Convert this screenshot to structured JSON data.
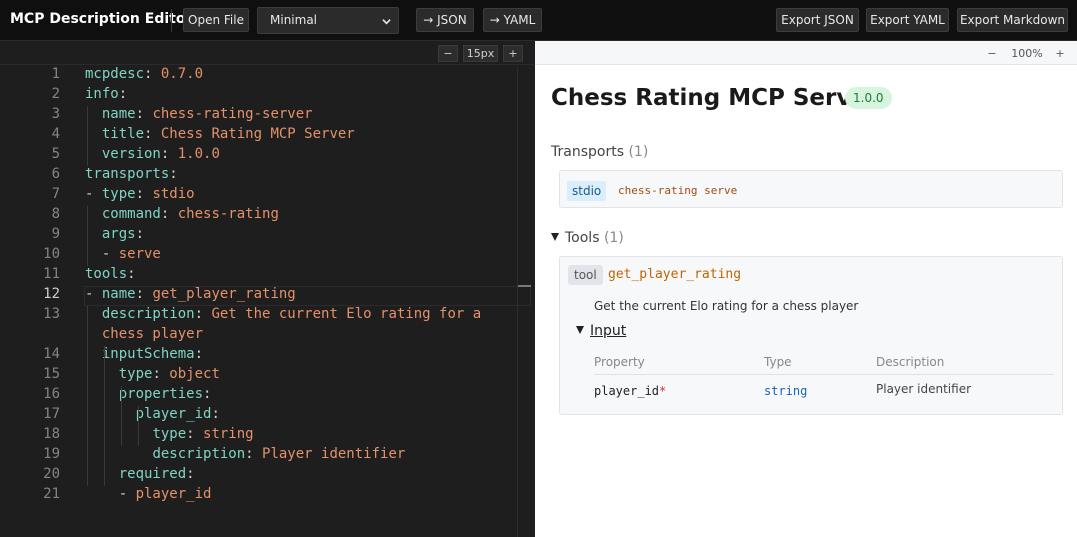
{
  "app": {
    "title": "MCP Description Editor"
  },
  "toolbar": {
    "open_file": "Open File",
    "preset_select": "Minimal",
    "to_json": "→ JSON",
    "to_yaml": "→ YAML",
    "export_json": "Export JSON",
    "export_yaml": "Export YAML",
    "export_markdown": "Export Markdown"
  },
  "editor": {
    "zoom_minus": "−",
    "font_size": "15px",
    "zoom_plus": "+",
    "active_line": 12,
    "lines": [
      {
        "n": "1",
        "tokens": [
          [
            "k",
            "mcpdesc"
          ],
          [
            "p",
            ": "
          ],
          [
            "v",
            "0.7.0"
          ]
        ]
      },
      {
        "n": "2",
        "tokens": [
          [
            "k",
            "info"
          ],
          [
            "p",
            ":"
          ]
        ]
      },
      {
        "n": "3",
        "tokens": [
          [
            "p",
            "  "
          ],
          [
            "k",
            "name"
          ],
          [
            "p",
            ": "
          ],
          [
            "v",
            "chess-rating-server"
          ]
        ]
      },
      {
        "n": "4",
        "tokens": [
          [
            "p",
            "  "
          ],
          [
            "k",
            "title"
          ],
          [
            "p",
            ": "
          ],
          [
            "v",
            "Chess Rating MCP Server"
          ]
        ]
      },
      {
        "n": "5",
        "tokens": [
          [
            "p",
            "  "
          ],
          [
            "k",
            "version"
          ],
          [
            "p",
            ": "
          ],
          [
            "v",
            "1.0.0"
          ]
        ]
      },
      {
        "n": "6",
        "tokens": [
          [
            "k",
            "transports"
          ],
          [
            "p",
            ":"
          ]
        ]
      },
      {
        "n": "7",
        "tokens": [
          [
            "p",
            "- "
          ],
          [
            "k",
            "type"
          ],
          [
            "p",
            ": "
          ],
          [
            "v",
            "stdio"
          ]
        ]
      },
      {
        "n": "8",
        "tokens": [
          [
            "p",
            "  "
          ],
          [
            "k",
            "command"
          ],
          [
            "p",
            ": "
          ],
          [
            "v",
            "chess-rating"
          ]
        ]
      },
      {
        "n": "9",
        "tokens": [
          [
            "p",
            "  "
          ],
          [
            "k",
            "args"
          ],
          [
            "p",
            ":"
          ]
        ]
      },
      {
        "n": "10",
        "tokens": [
          [
            "p",
            "  - "
          ],
          [
            "v",
            "serve"
          ]
        ]
      },
      {
        "n": "11",
        "tokens": [
          [
            "k",
            "tools"
          ],
          [
            "p",
            ":"
          ]
        ]
      },
      {
        "n": "12",
        "tokens": [
          [
            "p",
            "- "
          ],
          [
            "k",
            "name"
          ],
          [
            "p",
            ": "
          ],
          [
            "v",
            "get_player_rating"
          ]
        ]
      },
      {
        "n": "13",
        "tokens": [
          [
            "p",
            "  "
          ],
          [
            "k",
            "description"
          ],
          [
            "p",
            ": "
          ],
          [
            "v",
            "Get the current Elo rating for a"
          ]
        ]
      },
      {
        "n": "",
        "tokens": [
          [
            "p",
            "  "
          ],
          [
            "v",
            "chess player"
          ]
        ]
      },
      {
        "n": "14",
        "tokens": [
          [
            "p",
            "  "
          ],
          [
            "k",
            "inputSchema"
          ],
          [
            "p",
            ":"
          ]
        ]
      },
      {
        "n": "15",
        "tokens": [
          [
            "p",
            "    "
          ],
          [
            "k",
            "type"
          ],
          [
            "p",
            ": "
          ],
          [
            "v",
            "object"
          ]
        ]
      },
      {
        "n": "16",
        "tokens": [
          [
            "p",
            "    "
          ],
          [
            "k",
            "properties"
          ],
          [
            "p",
            ":"
          ]
        ]
      },
      {
        "n": "17",
        "tokens": [
          [
            "p",
            "      "
          ],
          [
            "k",
            "player_id"
          ],
          [
            "p",
            ":"
          ]
        ]
      },
      {
        "n": "18",
        "tokens": [
          [
            "p",
            "        "
          ],
          [
            "k",
            "type"
          ],
          [
            "p",
            ": "
          ],
          [
            "v",
            "string"
          ]
        ]
      },
      {
        "n": "19",
        "tokens": [
          [
            "p",
            "        "
          ],
          [
            "k",
            "description"
          ],
          [
            "p",
            ": "
          ],
          [
            "v",
            "Player identifier"
          ]
        ]
      },
      {
        "n": "20",
        "tokens": [
          [
            "p",
            "    "
          ],
          [
            "k",
            "required"
          ],
          [
            "p",
            ":"
          ]
        ]
      },
      {
        "n": "21",
        "tokens": [
          [
            "p",
            "    - "
          ],
          [
            "v",
            "player_id"
          ]
        ]
      }
    ]
  },
  "preview": {
    "zoom_minus": "−",
    "zoom_level": "100%",
    "zoom_plus": "+",
    "server_title": "Chess Rating MCP Server",
    "version_badge": "1.0.0",
    "transports": {
      "heading": "Transports",
      "count": "(1)",
      "type_chip": "stdio",
      "command": "chess-rating serve"
    },
    "tools": {
      "heading": "Tools",
      "count": "(1)",
      "tool_chip": "tool",
      "tool_name": "get_player_rating",
      "tool_description": "Get the current Elo rating for a chess player",
      "input_heading": "Input",
      "columns": [
        "Property",
        "Type",
        "Description"
      ],
      "rows": [
        {
          "property": "player_id",
          "required_mark": "*",
          "type": "string",
          "description": "Player identifier"
        }
      ]
    }
  },
  "colors": {
    "yaml_key": "#7fd4c4",
    "yaml_value": "#e5916a",
    "badge_bg": "#d6f5dc",
    "tool_name": "#c26400"
  }
}
